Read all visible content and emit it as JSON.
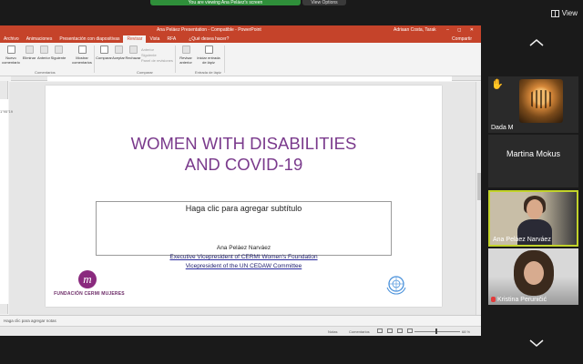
{
  "zoom": {
    "banner": "You are viewing Ana Peláez's screen",
    "view_options": "View Options",
    "view_button": "View"
  },
  "ppt": {
    "window_title": "Ana Peláez Presentation - Compatible - PowerPoint",
    "user": "Adriaan Costa, Tarak",
    "share": "Compartir",
    "window_controls": "– ◻ ✕",
    "tabs": [
      "Archivo",
      "Animaciones",
      "Presentación con diapositivas",
      "Revisar",
      "Vista",
      "RFA"
    ],
    "active_tab_index": 3,
    "tell_me": "¿Qué desea hacer?",
    "ribbon": {
      "buttons": [
        "Nuevo comentario",
        "Eliminar",
        "Anterior",
        "Siguiente",
        "Mostrar comentarios",
        "Comparar",
        "Aceptar",
        "Rechazar",
        "Revisar anterior",
        "Iniciar entrada de lápiz"
      ],
      "small": [
        "Anterior",
        "Siguiente",
        "Panel de revisiones"
      ],
      "groups": [
        "Comentarios",
        "Comparar",
        "Entrada de lápiz"
      ]
    },
    "notes_placeholder": "Haga clic para agregar notas",
    "status": {
      "notes": "Notas",
      "comments": "Comentarios",
      "zoom": "68 %"
    },
    "left_ruler_mark": "1\"95\"19"
  },
  "slide": {
    "title_line1": "WOMEN WITH DISABILITIES",
    "title_line2": "AND COVID-19",
    "subtitle_placeholder": "Haga clic para agregar subtítulo",
    "presenter": "Ana Peláez Narváez",
    "role1": "Executive Vicepresident of CERMI Women's Foundation",
    "role2": "Vicepresident of the UN CEDAW Committee",
    "logo_letter": "m",
    "logo_text": "FUNDACIÓN CERMI MUJERES"
  },
  "participants": [
    {
      "name": "Dada M",
      "raised_hand": true
    },
    {
      "name": "Martina Mokus"
    },
    {
      "name": "Ana Peláez Narváez",
      "active_speaker": true
    },
    {
      "name": "Kristina Peruničić",
      "muted": true
    }
  ],
  "colors": {
    "ppt_accent": "#c5432a",
    "title_purple": "#7a3a8c",
    "active_border": "#c2d32a"
  }
}
